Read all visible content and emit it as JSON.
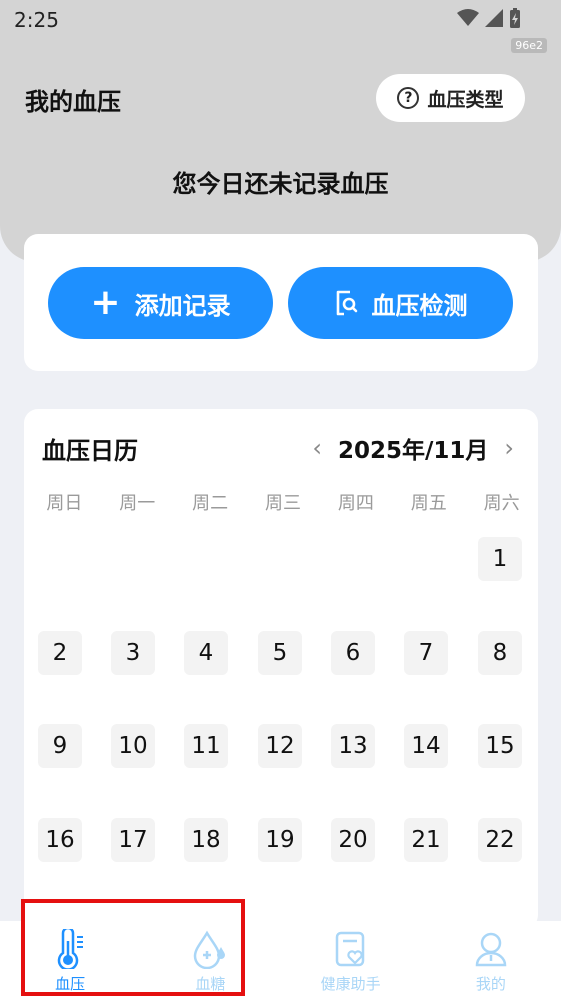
{
  "status_bar": {
    "time": "2:25",
    "tag": "96e2"
  },
  "header": {
    "title": "我的血压",
    "type_button": "血压类型",
    "help_glyph": "?",
    "notice": "您今日还未记录血压"
  },
  "actions": {
    "add_label": "添加记录",
    "detect_label": "血压检测"
  },
  "calendar": {
    "title": "血压日历",
    "month": "2025年/11月",
    "prev_glyph": "‹",
    "next_glyph": "›",
    "weekdays": [
      "周日",
      "周一",
      "周二",
      "周三",
      "周四",
      "周五",
      "周六"
    ],
    "days": [
      "1",
      "2",
      "3",
      "4",
      "5",
      "6",
      "7",
      "8",
      "9",
      "10",
      "11",
      "12",
      "13",
      "14",
      "15",
      "16",
      "17",
      "18",
      "19",
      "20",
      "21",
      "22"
    ]
  },
  "tabbar": {
    "items": [
      {
        "label": "血压",
        "icon": "thermometer-icon",
        "active": true
      },
      {
        "label": "血糖",
        "icon": "blood-drop-icon",
        "active": false
      },
      {
        "label": "健康助手",
        "icon": "health-assistant-icon",
        "active": false
      },
      {
        "label": "我的",
        "icon": "profile-icon",
        "active": false
      }
    ]
  },
  "colors": {
    "accent": "#1e90ff",
    "header_bg": "#d4d4d4",
    "highlight": "#e51010",
    "inactive_tab": "#a9d6f7"
  }
}
